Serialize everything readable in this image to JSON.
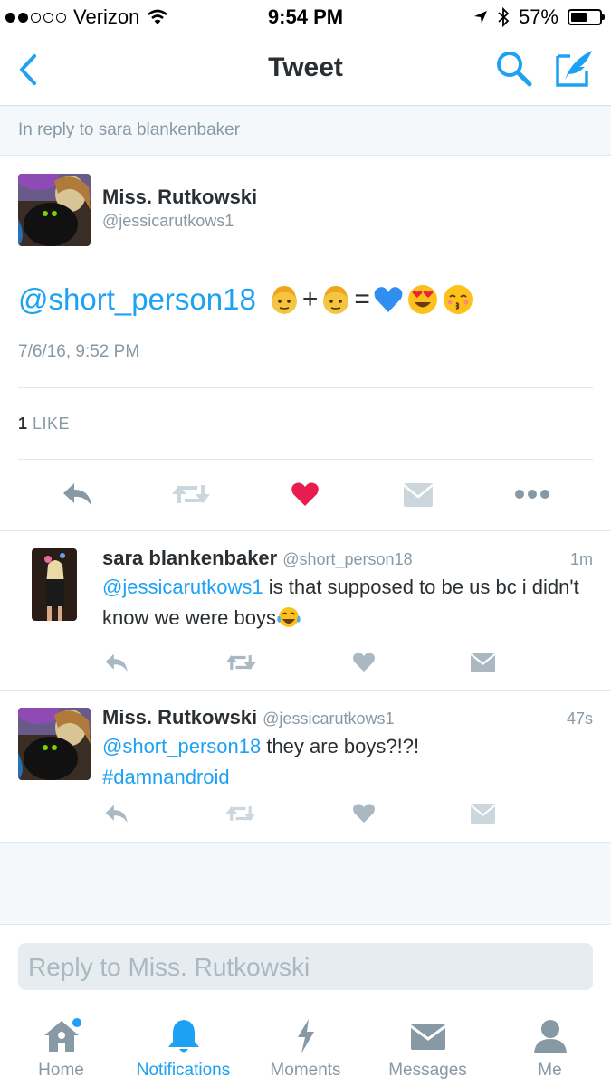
{
  "status_bar": {
    "carrier": "Verizon",
    "time": "9:54 PM",
    "battery": "57%",
    "battery_level": 0.57,
    "signal_bars": 2
  },
  "nav": {
    "title": "Tweet",
    "back_icon": "chevron-left-icon",
    "search_icon": "search-icon",
    "compose_icon": "compose-icon"
  },
  "reply_context": "In reply to sara blankenbaker",
  "tweet": {
    "name": "Miss. Rutkowski",
    "handle": "@jessicarutkows1",
    "mention": "@short_person18",
    "emoji": [
      "man-emoji",
      "+",
      "man-emoji",
      "=",
      "blue-heart-emoji",
      "heart-eyes-emoji",
      "kissing-emoji"
    ],
    "timestamp": "7/6/16, 9:52 PM",
    "likes_count": "1",
    "likes_label": "LIKE",
    "liked": true
  },
  "replies": [
    {
      "name": "sara blankenbaker",
      "handle": "@short_person18",
      "time": "1m",
      "mention": "@jessicarutkows1",
      "text": " is that supposed to be us bc i didn't know we were boys",
      "trailing_emoji": "tears-of-joy-emoji"
    },
    {
      "name": "Miss. Rutkowski",
      "handle": "@jessicarutkows1",
      "time": "47s",
      "mention": "@short_person18",
      "text": " they are boys?!?!",
      "hashtag": "#damnandroid"
    }
  ],
  "composer": {
    "placeholder": "Reply to Miss. Rutkowski"
  },
  "tabs": [
    {
      "label": "Home",
      "icon": "home-icon",
      "active": false,
      "has_dot": true
    },
    {
      "label": "Notifications",
      "icon": "bell-icon",
      "active": true
    },
    {
      "label": "Moments",
      "icon": "lightning-icon",
      "active": false
    },
    {
      "label": "Messages",
      "icon": "envelope-icon",
      "active": false
    },
    {
      "label": "Me",
      "icon": "person-icon",
      "active": false
    }
  ],
  "colors": {
    "accent": "#1da1f2",
    "like": "#e81c4f",
    "muted": "#8899a6",
    "action_gray": "#aab8c2"
  }
}
